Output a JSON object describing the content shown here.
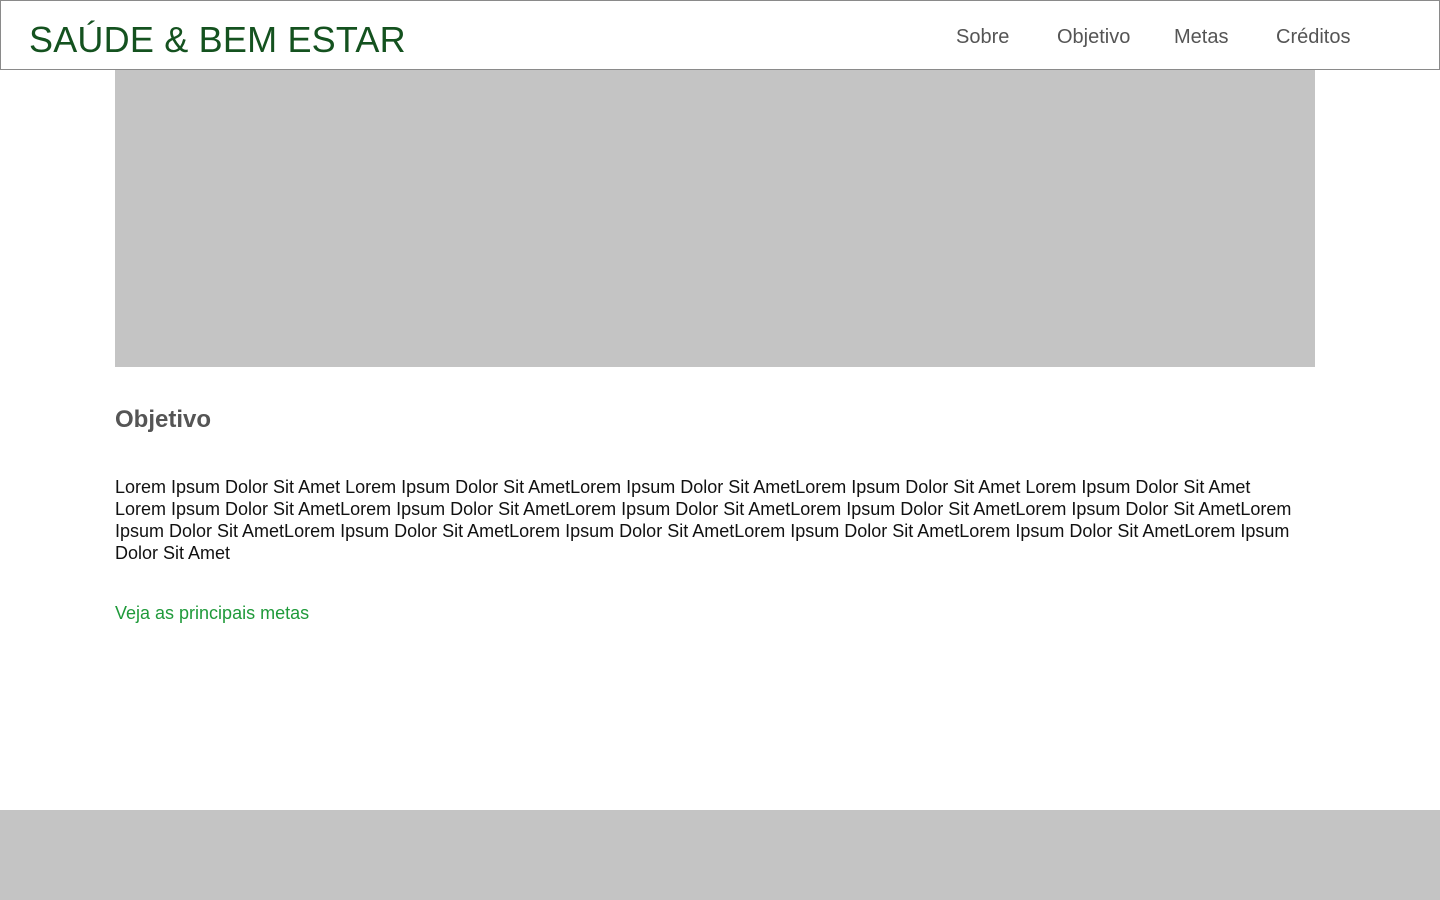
{
  "header": {
    "brand": "SAÚDE & BEM ESTAR",
    "nav": {
      "sobre": "Sobre",
      "objetivo": "Objetivo",
      "metas": "Metas",
      "creditos": "Créditos"
    }
  },
  "colors": {
    "brand": "#14521f",
    "link": "#1f9a3a",
    "placeholder": "#c4c4c4",
    "nav_text": "#555555"
  },
  "main": {
    "section_title": "Objetivo",
    "section_body": "Lorem Ipsum Dolor Sit Amet Lorem Ipsum Dolor Sit AmetLorem Ipsum Dolor Sit AmetLorem Ipsum Dolor Sit Amet Lorem Ipsum Dolor Sit Amet Lorem Ipsum Dolor Sit AmetLorem Ipsum Dolor Sit AmetLorem Ipsum Dolor Sit AmetLorem Ipsum Dolor Sit AmetLorem Ipsum Dolor Sit AmetLorem Ipsum Dolor Sit AmetLorem Ipsum Dolor Sit AmetLorem Ipsum Dolor Sit AmetLorem Ipsum Dolor Sit AmetLorem Ipsum Dolor Sit AmetLorem Ipsum Dolor Sit Amet",
    "cta_link": "Veja as principais metas"
  }
}
